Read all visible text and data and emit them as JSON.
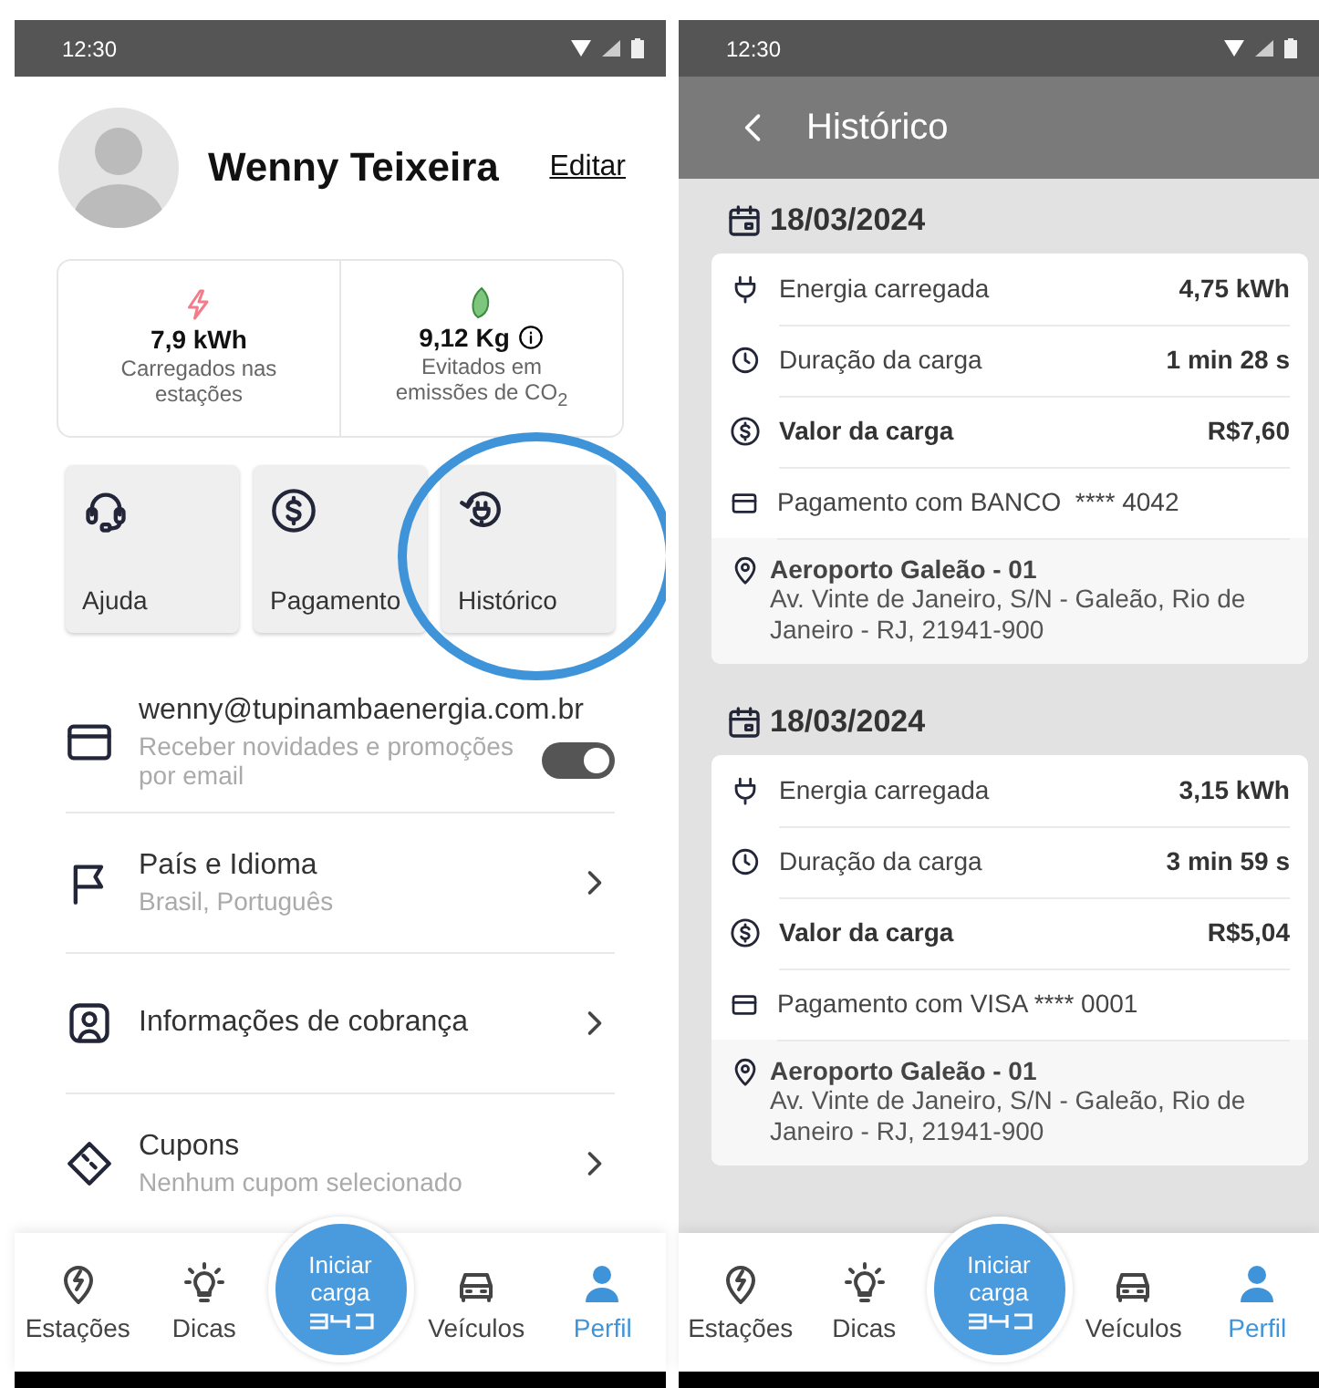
{
  "profile_screen": {
    "status_bar": {
      "time": "12:30"
    },
    "user": {
      "name": "Wenny Teixeira",
      "edit_link": "Editar"
    },
    "stats": [
      {
        "kind": "energy",
        "value": "7,9 kWh",
        "caption": "Carregados nas estações"
      },
      {
        "kind": "co2",
        "value": "9,12 Kg",
        "caption": "Evitados em emissões de CO$_{2}$"
      }
    ],
    "shortcuts": [
      {
        "kind": "help",
        "label": "Ajuda",
        "highlighted": false
      },
      {
        "kind": "payment",
        "label": "Pagamento",
        "highlighted": false
      },
      {
        "kind": "history",
        "label": "Histórico",
        "highlighted": true
      }
    ],
    "settings": [
      {
        "kind": "email",
        "title": "wenny@tupinambaenergia.com.br",
        "subtitle": "Receber novidades e promoções por email",
        "toggle": {
          "on": true
        }
      },
      {
        "kind": "language",
        "title": "País e Idioma",
        "subtitle": "Brasil, Português"
      },
      {
        "kind": "billing",
        "title": "Informações de cobrança"
      },
      {
        "kind": "coupons",
        "title": "Cupons",
        "subtitle": "Nenhum cupom selecionado"
      }
    ],
    "bottom_nav": {
      "start_button": {
        "label": "Iniciar carga"
      },
      "items": [
        {
          "kind": "stations",
          "label": "Estações",
          "selected": false
        },
        {
          "kind": "tips",
          "label": "Dicas",
          "selected": false
        },
        {
          "kind": "vehicles",
          "label": "Veículos",
          "selected": false
        },
        {
          "kind": "profile",
          "label": "Perfil",
          "selected": true
        }
      ]
    }
  },
  "history_screen": {
    "status_bar": {
      "time": "12:30"
    },
    "title": "Histórico",
    "sessions": [
      {
        "date": "18/03/2024",
        "rows": [
          {
            "kind": "energy",
            "label": "Energia carregada",
            "value": "4,75 kWh"
          },
          {
            "kind": "duration",
            "label": "Duração da carga",
            "value": "1 min 28 s"
          },
          {
            "kind": "cost",
            "label": "Valor da carga",
            "value": "R$7,60"
          },
          {
            "kind": "payment",
            "label": "Pagamento com BANCO  **** 4042"
          }
        ],
        "location": {
          "name": "Aeroporto Galeão - 01",
          "address": "Av. Vinte de Janeiro, S/N - Galeão, Rio de Janeiro - RJ, 21941-900"
        }
      },
      {
        "date": "18/03/2024",
        "rows": [
          {
            "kind": "energy",
            "label": "Energia carregada",
            "value": "3,15 kWh"
          },
          {
            "kind": "duration",
            "label": "Duração da carga",
            "value": "3 min 59 s"
          },
          {
            "kind": "cost",
            "label": "Valor da carga",
            "value": "R$5,04"
          },
          {
            "kind": "payment",
            "label": "Pagamento com VISA **** 0001"
          }
        ],
        "location": {
          "name": "Aeroporto Galeão - 01",
          "address": "Av. Vinte de Janeiro, S/N - Galeão, Rio de Janeiro - RJ, 21941-900"
        }
      }
    ],
    "bottom_nav": {
      "start_button": {
        "label": "Iniciar carga"
      },
      "items": [
        {
          "kind": "stations",
          "label": "Estações",
          "selected": false
        },
        {
          "kind": "tips",
          "label": "Dicas",
          "selected": false
        },
        {
          "kind": "vehicles",
          "label": "Veículos",
          "selected": false
        },
        {
          "kind": "profile",
          "label": "Perfil",
          "selected": true
        }
      ]
    }
  }
}
